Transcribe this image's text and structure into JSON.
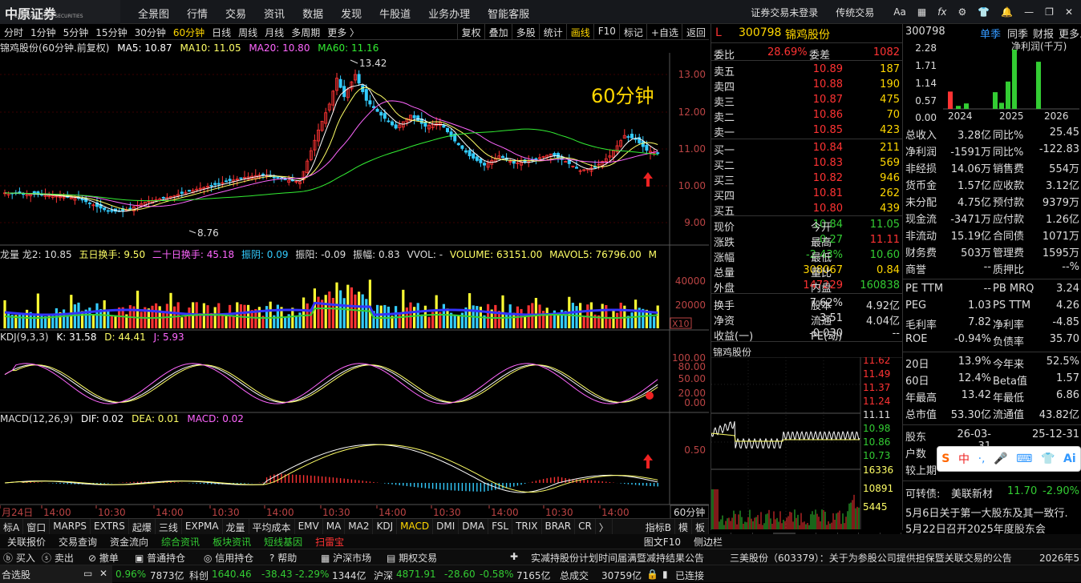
{
  "app": {
    "logo": "中原证券",
    "logo_sub": "CENTRAL CHINA SECURITIES"
  },
  "menu": [
    "全景图",
    "行情",
    "交易",
    "资讯",
    "数据",
    "发现",
    "牛股道",
    "业务办理",
    "智能客服"
  ],
  "topright": {
    "login": "证券交易未登录",
    "mode": "传统交易"
  },
  "period_tabs": [
    "分时",
    "1分钟",
    "5分钟",
    "15分钟",
    "30分钟",
    "60分钟",
    "日线",
    "周线",
    "月线",
    "多周期",
    "更多 〉"
  ],
  "active_period": "60分钟",
  "tool_tabs": [
    "复权",
    "叠加",
    "多股",
    "统计",
    "画线",
    "F10",
    "标记",
    "+自选",
    "返回"
  ],
  "main_legend": {
    "name": "锦鸡股份(60分钟.前复权)",
    "ma5": "MA5: 10.87",
    "ma10": "MA10: 11.05",
    "ma20": "MA20: 10.80",
    "ma60": "MA60: 11.16"
  },
  "overlay_label": "60分钟",
  "price_axis": [
    "13.00",
    "12.00",
    "11.00",
    "10.00",
    "9.00"
  ],
  "price_marks": {
    "high": "13.42",
    "low": "8.76"
  },
  "vol_legend": {
    "a": "龙量 龙2: 10.85",
    "b": "五日换手: 9.50",
    "c": "二十日换手: 45.18",
    "d": "振阴: 0.09",
    "e": "振阳: -0.09",
    "f": "振幅: 0.83",
    "g": "VVOL: -",
    "h": "VOLUME: 63151.00",
    "i": "MAVOL5: 76796.00",
    "j": "M"
  },
  "vol_axis": [
    "40000",
    "20000"
  ],
  "vol_unit": "X10",
  "kdj_legend": {
    "a": "KDJ(9,3,3)",
    "k": "K: 31.58",
    "d": "D: 44.41",
    "j": "J: 5.93"
  },
  "kdj_axis": [
    "100.00",
    "80.00",
    "50.00",
    "20.00",
    "0.00"
  ],
  "macd_legend": {
    "a": "MACD(12,26,9)",
    "dif": "DIF: 0.02",
    "dea": "DEA: 0.01",
    "macd": "MACD: 0.02"
  },
  "macd_axis": [
    "0.50"
  ],
  "time_axis": [
    "月24日",
    "14:00",
    "10:30",
    "14:00",
    "10:30",
    "14:00",
    "10:30",
    "14:00",
    "10:30",
    "14:00",
    "10:30",
    "14:00"
  ],
  "time_period": "60分钟",
  "indicator_tabs": [
    "标A",
    "窗口",
    "MARPS",
    "EXTRS",
    "起爆",
    "三线",
    "EXPMA",
    "龙量",
    "平均成本",
    "EMV",
    "MA",
    "MA2",
    "KDJ",
    "MACD",
    "DMI",
    "DMA",
    "FSL",
    "TRIX",
    "BRAR",
    "CR",
    "〉",
    "指标B",
    "模",
    "板"
  ],
  "indicator_active": "MACD",
  "stock": {
    "code": "300798",
    "name": "锦鸡股份",
    "flag": "L"
  },
  "weibi": {
    "l1": "委比",
    "v1": "28.69%",
    "l2": "委差",
    "v2": "1082"
  },
  "sells": [
    [
      "卖五",
      "10.89",
      "187"
    ],
    [
      "卖四",
      "10.88",
      "190"
    ],
    [
      "卖三",
      "10.87",
      "475"
    ],
    [
      "卖二",
      "10.86",
      "70"
    ],
    [
      "卖一",
      "10.85",
      "423"
    ]
  ],
  "buys": [
    [
      "买一",
      "10.84",
      "211"
    ],
    [
      "买二",
      "10.83",
      "569"
    ],
    [
      "买三",
      "10.82",
      "946"
    ],
    [
      "买四",
      "10.81",
      "262"
    ],
    [
      "买五",
      "10.80",
      "439"
    ]
  ],
  "stats": [
    [
      "现价",
      "10.84",
      "今开",
      "11.05"
    ],
    [
      "涨跌",
      "-0.27",
      "最高",
      "11.11"
    ],
    [
      "涨幅",
      "-2.43%",
      "最低",
      "10.60"
    ],
    [
      "总量",
      "308067",
      "量比",
      "0.84"
    ],
    [
      "外盘",
      "147229",
      "内盘",
      "160838"
    ]
  ],
  "stats2": [
    [
      "换手",
      "7.62%",
      "股本",
      "4.92亿"
    ],
    [
      "净资",
      "3.51",
      "流通",
      "4.04亿"
    ],
    [
      "收益(一)",
      "-0.030",
      "PE(动)",
      "--"
    ]
  ],
  "mini": {
    "title": "锦鸡股份",
    "axis": [
      "11.62",
      "11.49",
      "11.37",
      "11.24",
      "11.11",
      "10.98",
      "10.86",
      "10.73"
    ],
    "vol_axis": [
      "16336",
      "10891",
      "5445"
    ]
  },
  "rp_tabs": [
    "笔",
    "价",
    "细",
    "势",
    "联",
    "值",
    "主",
    "逆",
    "筹"
  ],
  "fin": {
    "code": "300798",
    "tabs": [
      "单季",
      "同季",
      "财报",
      "更多.."
    ],
    "chart_title": "净利润(千万)",
    "y_axis": [
      "2.28",
      "1.71",
      "1.14",
      "0.57",
      "0.00"
    ],
    "x_axis": [
      "2024",
      "2025",
      "2026"
    ],
    "rows": [
      [
        "总收入",
        "3.28亿",
        "同比%",
        "25.45"
      ],
      [
        "净利润",
        "-1591万",
        "同比%",
        "-122.83"
      ],
      [
        "非经损",
        "14.06万",
        "销售费",
        "554万"
      ],
      [
        "货币金",
        "1.57亿",
        "应收款",
        "3.12亿"
      ],
      [
        "未分配",
        "4.75亿",
        "预付款",
        "9379万"
      ],
      [
        "现金流",
        "-3471万",
        "应付款",
        "1.26亿"
      ],
      [
        "非流动",
        "15.19亿",
        "合同债",
        "1071万"
      ],
      [
        "财务费",
        "503万",
        "管理费",
        "1595万"
      ],
      [
        "商誉",
        "--",
        "质押比",
        "--%"
      ]
    ],
    "rows2": [
      [
        "PE TTM",
        "--",
        "PB MRQ",
        "3.24"
      ],
      [
        "PEG",
        "1.03",
        "PS TTM",
        "4.26"
      ],
      [
        "毛利率",
        "7.82",
        "净利率",
        "-4.85"
      ],
      [
        "ROE",
        "-0.94%",
        "负债率",
        "35.70"
      ]
    ],
    "rows3": [
      [
        "20日",
        "13.9%",
        "今年来",
        "52.5%"
      ],
      [
        "60日",
        "12.4%",
        "Beta值",
        "1.57"
      ],
      [
        "年最高",
        "13.42",
        "年最低",
        "6.86"
      ],
      [
        "总市值",
        "53.30亿",
        "流通值",
        "43.82亿"
      ]
    ],
    "rows4": [
      [
        "股东",
        "26-03-31",
        "",
        "25-12-31"
      ],
      [
        "户数",
        "",
        "",
        ""
      ],
      [
        "较上期",
        "-0.29%",
        "",
        "-0.90%"
      ]
    ],
    "convert": {
      "label": "可转债:",
      "name": "美联新材",
      "price": "11.70",
      "chg": "-2.90%"
    },
    "news": [
      "5月6日关于第一大股东及其一致行.",
      "5月22日召开2025年度股东会"
    ]
  },
  "bottom_links": [
    "关联报价",
    "交易查询",
    "资金流向",
    "综合资讯",
    "板块资讯",
    "短线基因",
    "扫雷宝"
  ],
  "side_f10": "图文F10",
  "side_bar": "侧边栏",
  "bottom_actions": [
    "买入",
    "卖出",
    "撤单",
    "普通持仓",
    "信用持仓",
    "帮助",
    "沪深市场",
    "期权交易"
  ],
  "ticker1": "实减持股份计划时间届满暨减持结果公告",
  "ticker2": "三美股份（603379）：关于为参股公司提供担保暨关联交易的公告",
  "ticker_date": "2026年5",
  "status": {
    "self": "合选股",
    "a": "0.96%",
    "b": "7873亿",
    "c": "科创",
    "d": "1640.46",
    "e": "-38.43",
    "f": "-2.29%",
    "g": "1344亿",
    "h": "沪深",
    "i": "4871.91",
    "j": "-28.60",
    "k": "-0.58%",
    "l": "7165亿",
    "m": "总成交",
    "n": "30759亿",
    "o": "已连接"
  },
  "colors": {
    "up": "#f33",
    "down": "#3c3",
    "ma5": "#ffffff",
    "ma10": "#ffff66",
    "ma20": "#ff66ff",
    "ma60": "#33ee33",
    "accent": "#ffd700"
  },
  "chart_data": {
    "type": "candlestick",
    "high": 13.42,
    "low": 8.76,
    "ylim": [
      8.6,
      13.6
    ]
  }
}
